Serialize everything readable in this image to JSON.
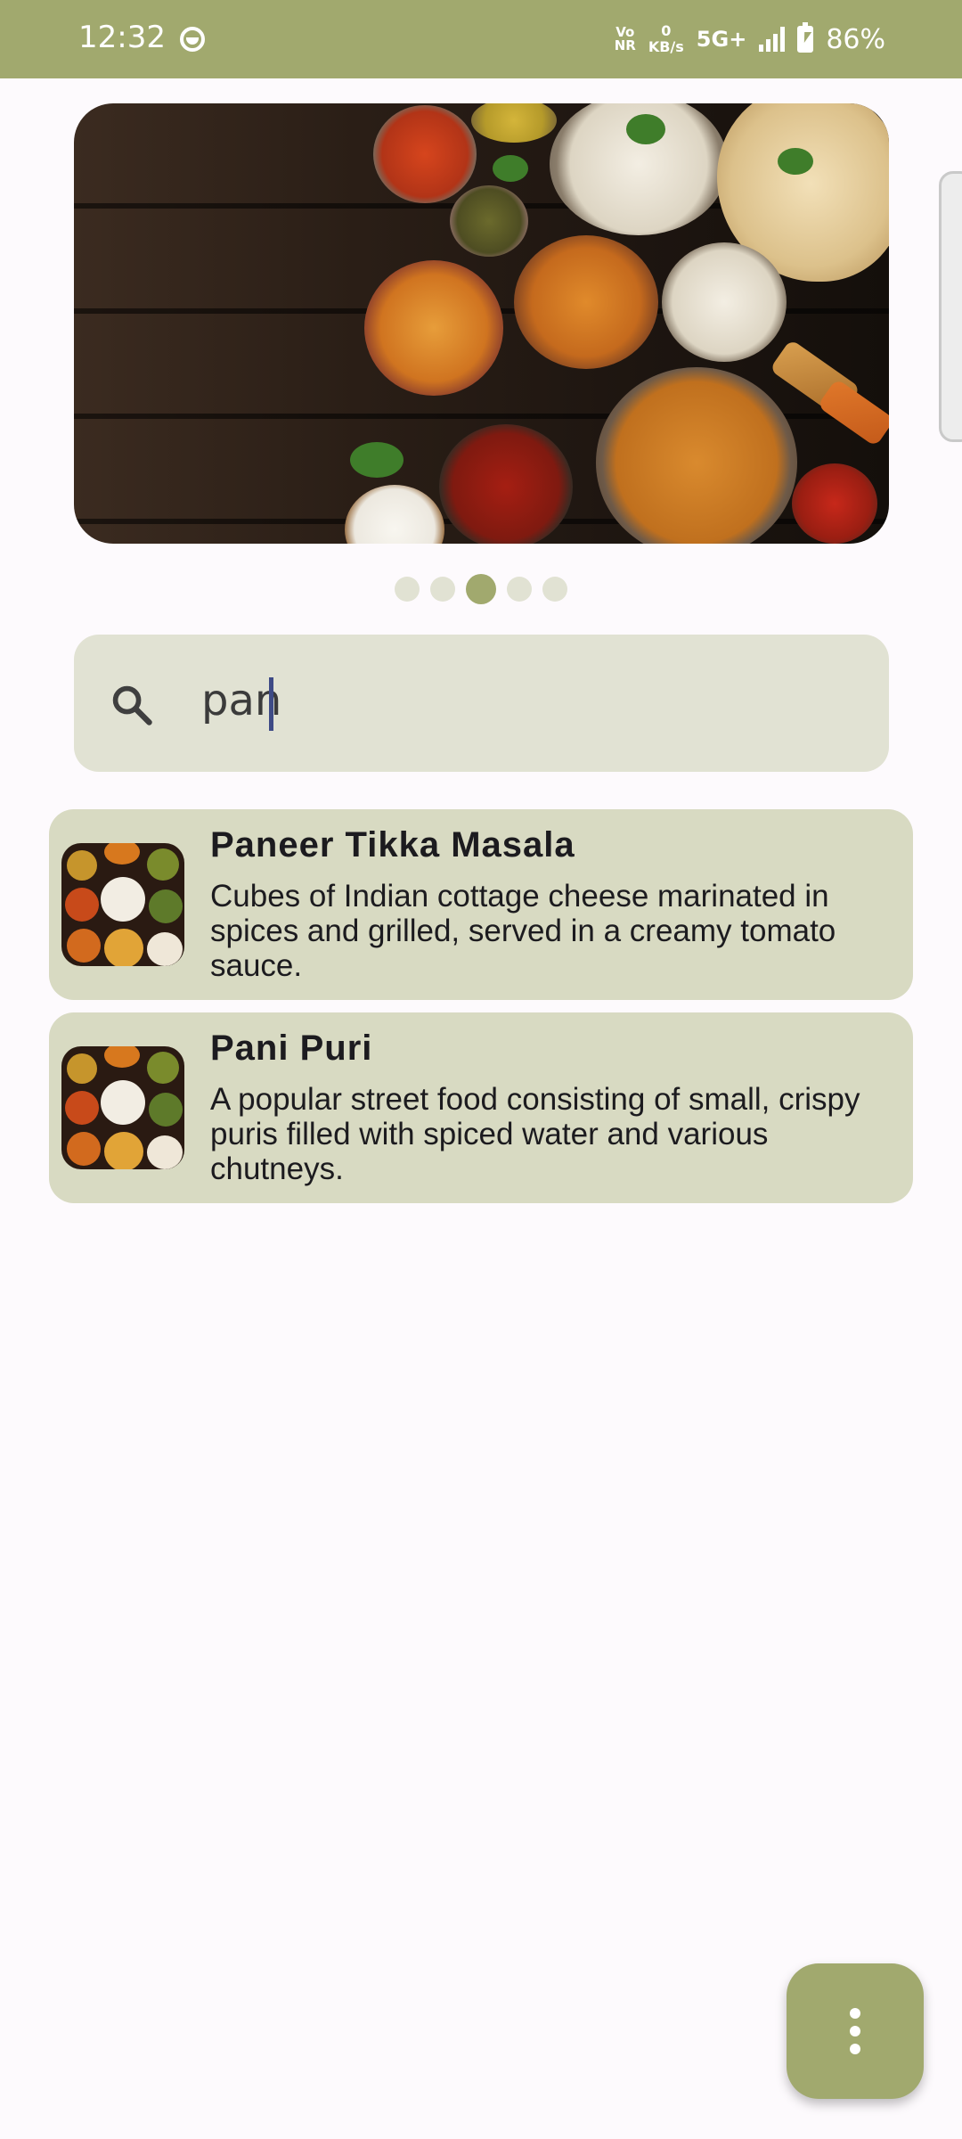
{
  "status_bar": {
    "time": "12:32",
    "volte_top": "Vo",
    "volte_bottom": "NR",
    "speed_value": "0",
    "speed_unit": "KB/s",
    "network": "5G+",
    "battery": "86%",
    "background_color": "#a1a96e"
  },
  "carousel": {
    "page_count": 5,
    "active_index": 2,
    "image_name": "indian-food-spread-image"
  },
  "search": {
    "value": "pan",
    "icon": "search-icon"
  },
  "results": [
    {
      "title": "Paneer Tikka Masala",
      "description": "Cubes of Indian cottage cheese marinated in spices and grilled, served in a creamy tomato sauce.",
      "thumbnail": "food-thumbnail"
    },
    {
      "title": "Pani Puri",
      "description": "A popular street food consisting of small, crispy puris filled with spiced water and various chutneys.",
      "thumbnail": "food-thumbnail"
    }
  ],
  "fab": {
    "icon": "more-vert-icon",
    "color": "#a1a96e"
  },
  "colors": {
    "accent": "#a1a96e",
    "card_background": "#d8dac2",
    "search_background": "#e1e2d3",
    "page_background": "#fdfafd"
  }
}
